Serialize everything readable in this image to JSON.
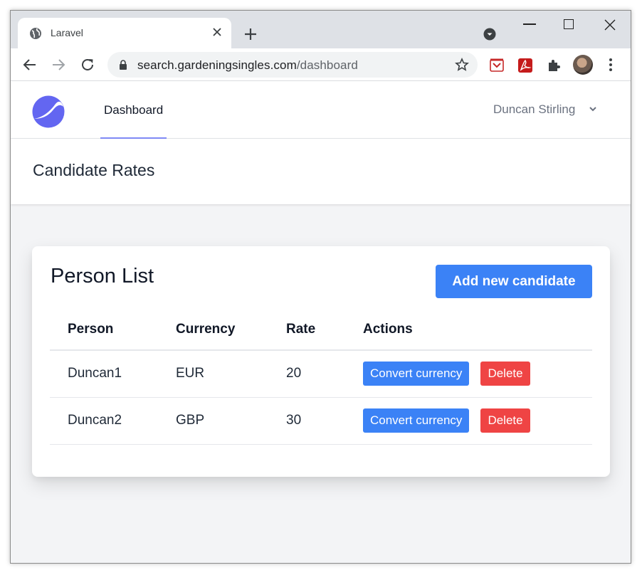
{
  "browser": {
    "tab_title": "Laravel",
    "url_host": "search.gardeningsingles.com",
    "url_path": "/dashboard"
  },
  "nav": {
    "dashboard_label": "Dashboard",
    "user_name": "Duncan Stirling"
  },
  "header": {
    "title": "Candidate Rates"
  },
  "card": {
    "title": "Person List",
    "add_button": "Add new candidate",
    "columns": [
      "Person",
      "Currency",
      "Rate",
      "Actions"
    ],
    "rows": [
      {
        "person": "Duncan1",
        "currency": "EUR",
        "rate": "20",
        "convert_label": "Convert currency",
        "delete_label": "Delete"
      },
      {
        "person": "Duncan2",
        "currency": "GBP",
        "rate": "30",
        "convert_label": "Convert currency",
        "delete_label": "Delete"
      }
    ]
  },
  "colors": {
    "primary": "#3b82f6",
    "danger": "#ef4444",
    "logo": "#6366f1",
    "nav_underline": "#818cf8"
  }
}
